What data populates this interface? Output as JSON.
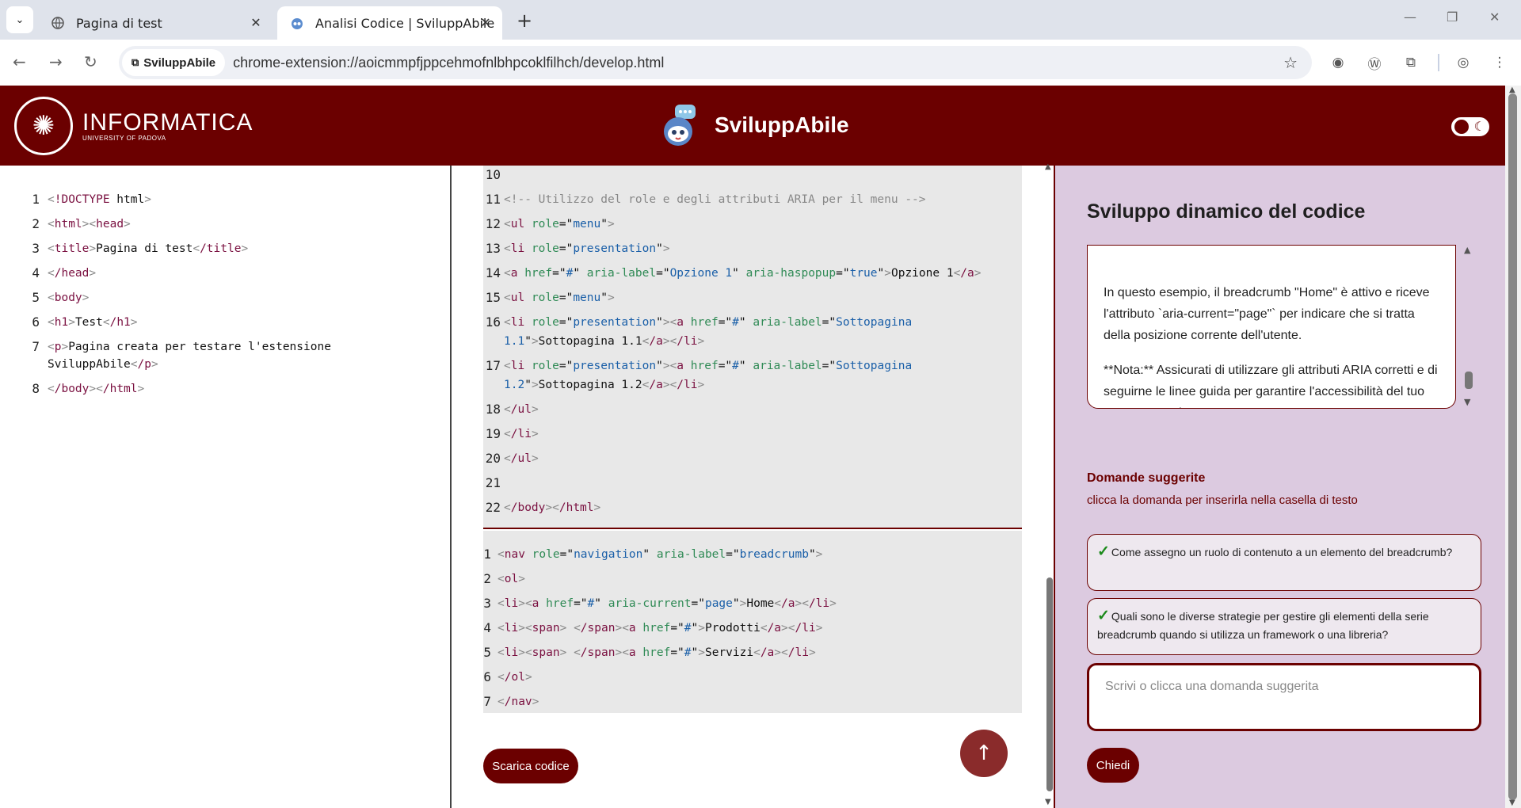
{
  "browser": {
    "tabs": [
      {
        "title": "Pagina di test",
        "icon": "globe-icon"
      },
      {
        "title": "Analisi Codice | SviluppAbile",
        "icon": "mascot-icon"
      }
    ],
    "site_chip": "SviluppAbile",
    "url": "chrome-extension://aoicmmpfjppcehmofnlbhpcoklfilhch/develop.html"
  },
  "header": {
    "university": "INFORMATICA",
    "university_sub": "UNIVERSITY OF PADOVA",
    "app_title": "SviluppAbile"
  },
  "source_code": [
    {
      "n": "1",
      "text": "<!DOCTYPE html>"
    },
    {
      "n": "2",
      "text": "<html><head>"
    },
    {
      "n": "3",
      "text": "<title>Pagina di test</title>"
    },
    {
      "n": "4",
      "text": "</head>"
    },
    {
      "n": "5",
      "text": "<body>"
    },
    {
      "n": "6",
      "text": "<h1>Test</h1>"
    },
    {
      "n": "7",
      "text": "<p>Pagina creata per testare l'estensione SviluppAbile</p>"
    },
    {
      "n": "8",
      "text": "</body></html>"
    }
  ],
  "generated_code": [
    {
      "n": "10",
      "text": ""
    },
    {
      "n": "11",
      "text": "<!-- Utilizzo del role e degli attributi ARIA per il menu -->"
    },
    {
      "n": "12",
      "text": "<ul role=\"menu\">"
    },
    {
      "n": "13",
      "text": "<li role=\"presentation\">"
    },
    {
      "n": "14",
      "text": "<a href=\"#\" aria-label=\"Opzione 1\" aria-haspopup=\"true\">Opzione 1</a>"
    },
    {
      "n": "15",
      "text": "<ul role=\"menu\">"
    },
    {
      "n": "16",
      "text": "<li role=\"presentation\"><a href=\"#\" aria-label=\"Sottopagina 1.1\">Sottopagina 1.1</a></li>"
    },
    {
      "n": "17",
      "text": "<li role=\"presentation\"><a href=\"#\" aria-label=\"Sottopagina 1.2\">Sottopagina 1.2</a></li>"
    },
    {
      "n": "18",
      "text": "</ul>"
    },
    {
      "n": "19",
      "text": "</li>"
    },
    {
      "n": "20",
      "text": "</ul>"
    },
    {
      "n": "21",
      "text": ""
    },
    {
      "n": "22",
      "text": "</body></html>"
    }
  ],
  "snippet_code": [
    {
      "n": "1",
      "text": "<nav role=\"navigation\" aria-label=\"breadcrumb\">"
    },
    {
      "n": "2",
      "text": "<ol>"
    },
    {
      "n": "3",
      "text": "<li><a href=\"#\" aria-current=\"page\">Home</a></li>"
    },
    {
      "n": "4",
      "text": "<li><span> </span><a href=\"#\">Prodotti</a></li>"
    },
    {
      "n": "5",
      "text": "<li><span> </span><a href=\"#\">Servizi</a></li>"
    },
    {
      "n": "6",
      "text": "</ol>"
    },
    {
      "n": "7",
      "text": "</nav>"
    }
  ],
  "download_label": "Scarica codice",
  "panel": {
    "title": "Sviluppo dinamico del codice",
    "answer_p1": "In questo esempio, il breadcrumb \"Home\" è attivo e riceve l'attributo `aria-current=\"page\"` per indicare che si tratta della posizione corrente dell'utente.",
    "answer_p2": "**Nota:** Assicurati di utilizzare gli attributi ARIA corretti e di seguirne le linee guida per garantire l'accessibilità del tuo contenuto web.",
    "suggested_title": "Domande suggerite",
    "suggested_sub": "clicca la domanda per inserirla nella casella di testo",
    "suggestions": [
      "Come assegno un ruolo di contenuto a un elemento del breadcrumb?",
      "Quali sono le diverse strategie per gestire gli elementi della serie breadcrumb quando si utilizza un framework o una libreria?"
    ],
    "input_placeholder": "Scrivi o clicca una domanda suggerita",
    "ask_label": "Chiedi"
  },
  "colors": {
    "brand": "#6b0000",
    "panel_bg": "#dccae0",
    "code_bg": "#e8e8e8"
  }
}
